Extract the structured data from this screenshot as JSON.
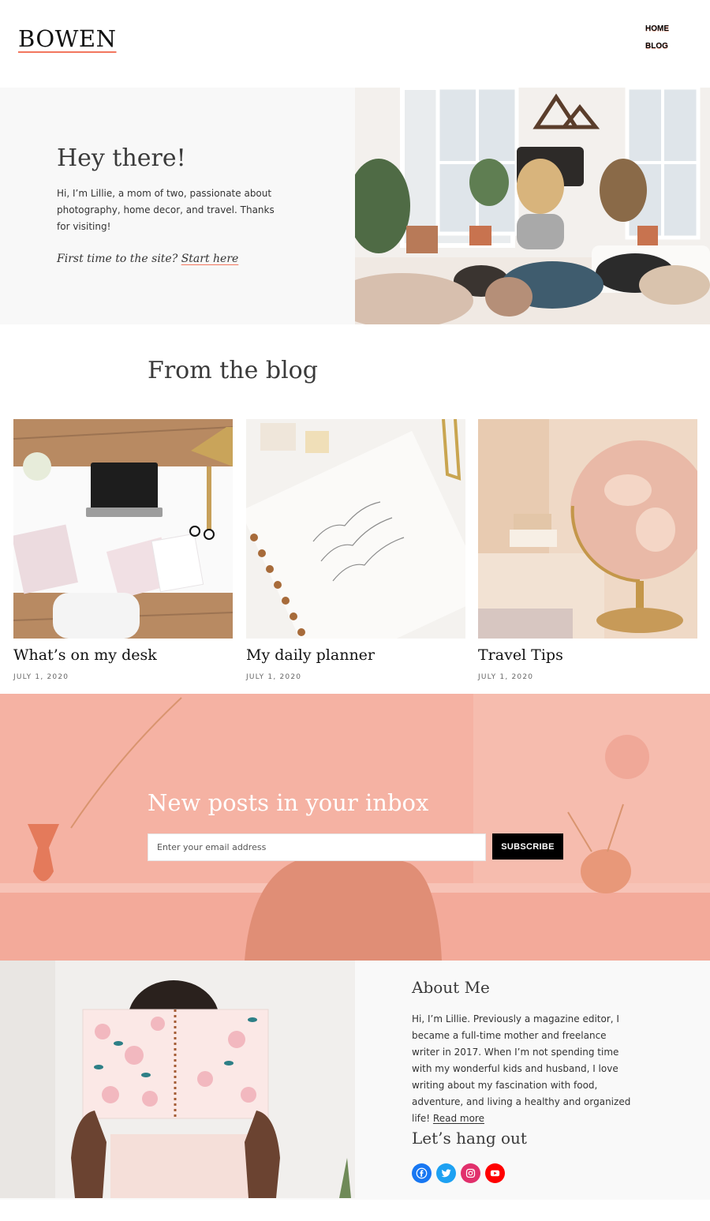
{
  "header": {
    "logo": "BOWEN",
    "nav": [
      "HOME",
      "BLOG"
    ]
  },
  "hero": {
    "title": "Hey there!",
    "text": "Hi, I’m Lillie, a mom of two, passionate about photography, home decor, and travel. Thanks for visiting!",
    "link_prefix": "First time to the site?",
    "link_text": "Start here"
  },
  "blog": {
    "heading": "From the blog",
    "posts": [
      {
        "title": "What’s on my desk",
        "date": "JULY 1, 2020"
      },
      {
        "title": "My daily planner",
        "date": "JULY 1, 2020"
      },
      {
        "title": "Travel Tips",
        "date": "JULY 1, 2020"
      }
    ]
  },
  "newsletter": {
    "title": "New posts in your inbox",
    "placeholder": "Enter your email address",
    "button": "SUBSCRIBE"
  },
  "about": {
    "title": "About Me",
    "text": "Hi, I’m Lillie. Previously a magazine editor, I became a full-time mother and freelance writer in 2017. When I’m not spending time with my wonderful kids and husband, I love writing about my fascination with food, adventure, and living a healthy and organized life!",
    "read_more": "Read more",
    "hang_title": "Let’s hang out",
    "socials": [
      {
        "icon": "facebook-icon",
        "color": "#1877f2"
      },
      {
        "icon": "twitter-icon",
        "color": "#1da1f2"
      },
      {
        "icon": "instagram-icon",
        "color": "#e1306c"
      },
      {
        "icon": "youtube-icon",
        "color": "#ff0000"
      }
    ]
  },
  "colors": {
    "accent": "#f2765e",
    "newsletter_bg": "#f5b2a3",
    "button_bg": "#000000"
  }
}
